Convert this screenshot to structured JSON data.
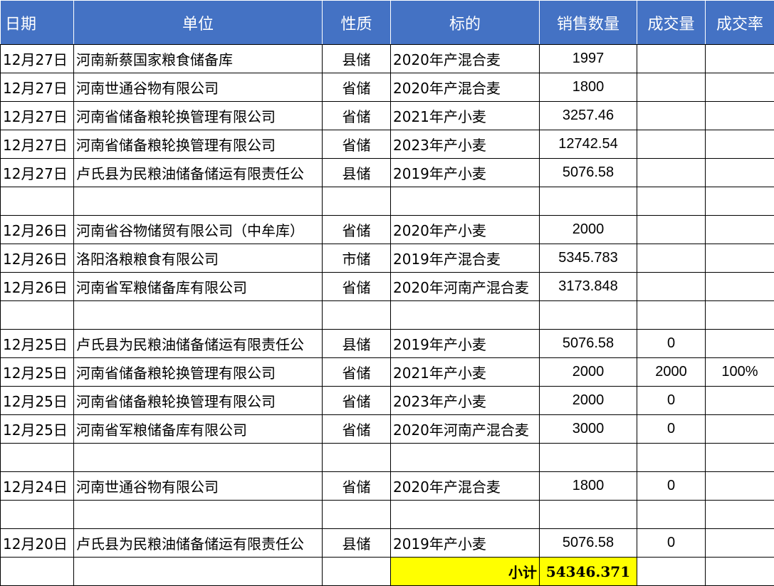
{
  "headers": [
    "日期",
    "单位",
    "性质",
    "标的",
    "销售数量",
    "成交量",
    "成交率"
  ],
  "rows": [
    {
      "date": "12月27日",
      "unit": "河南新蔡国家粮食储备库",
      "type": "县储",
      "item": "2020年产混合麦",
      "qty": "1997",
      "deal": "",
      "rate": ""
    },
    {
      "date": "12月27日",
      "unit": "河南世通谷物有限公司",
      "type": "省储",
      "item": "2020年产混合麦",
      "qty": "1800",
      "deal": "",
      "rate": ""
    },
    {
      "date": "12月27日",
      "unit": "河南省储备粮轮换管理有限公司",
      "type": "省储",
      "item": "2021年产小麦",
      "qty": "3257.46",
      "deal": "",
      "rate": ""
    },
    {
      "date": "12月27日",
      "unit": "河南省储备粮轮换管理有限公司",
      "type": "省储",
      "item": "2023年产小麦",
      "qty": "12742.54",
      "deal": "",
      "rate": ""
    },
    {
      "date": "12月27日",
      "unit": "卢氏县为民粮油储备储运有限责任公",
      "type": "县储",
      "item": "2019年产小麦",
      "qty": "5076.58",
      "deal": "",
      "rate": ""
    },
    {
      "date": "",
      "unit": "",
      "type": "",
      "item": "",
      "qty": "",
      "deal": "",
      "rate": ""
    },
    {
      "date": "12月26日",
      "unit": "河南省谷物储贸有限公司（中牟库）",
      "type": "省储",
      "item": "2020年产小麦",
      "qty": "2000",
      "deal": "",
      "rate": ""
    },
    {
      "date": "12月26日",
      "unit": "洛阳洛粮粮食有限公司",
      "type": "市储",
      "item": "2019年产混合麦",
      "qty": "5345.783",
      "deal": "",
      "rate": ""
    },
    {
      "date": "12月26日",
      "unit": "河南省军粮储备库有限公司",
      "type": "省储",
      "item": "2020年河南产混合麦",
      "qty": "3173.848",
      "deal": "",
      "rate": ""
    },
    {
      "date": "",
      "unit": "",
      "type": "",
      "item": "",
      "qty": "",
      "deal": "",
      "rate": ""
    },
    {
      "date": "12月25日",
      "unit": "卢氏县为民粮油储备储运有限责任公",
      "type": "县储",
      "item": "2019年产小麦",
      "qty": "5076.58",
      "deal": "0",
      "rate": ""
    },
    {
      "date": "12月25日",
      "unit": "河南省储备粮轮换管理有限公司",
      "type": "省储",
      "item": "2021年产小麦",
      "qty": "2000",
      "deal": "2000",
      "rate": "100%"
    },
    {
      "date": "12月25日",
      "unit": "河南省储备粮轮换管理有限公司",
      "type": "省储",
      "item": "2023年产小麦",
      "qty": "2000",
      "deal": "0",
      "rate": ""
    },
    {
      "date": "12月25日",
      "unit": "河南省军粮储备库有限公司",
      "type": "省储",
      "item": "2020年河南产混合麦",
      "qty": "3000",
      "deal": "0",
      "rate": ""
    },
    {
      "date": "",
      "unit": "",
      "type": "",
      "item": "",
      "qty": "",
      "deal": "",
      "rate": ""
    },
    {
      "date": "12月24日",
      "unit": "河南世通谷物有限公司",
      "type": "省储",
      "item": "2020年产混合麦",
      "qty": "1800",
      "deal": "0",
      "rate": ""
    },
    {
      "date": "",
      "unit": "",
      "type": "",
      "item": "",
      "qty": "",
      "deal": "",
      "rate": ""
    },
    {
      "date": "12月20日",
      "unit": "卢氏县为民粮油储备储运有限责任公",
      "type": "县储",
      "item": "2019年产小麦",
      "qty": "5076.58",
      "deal": "0",
      "rate": ""
    }
  ],
  "subtotal": {
    "label": "小计",
    "value": "54346.371"
  },
  "colors": {
    "header_bg": "#4472c4",
    "header_text": "#ffffff",
    "subtotal_bg": "#ffff00"
  }
}
